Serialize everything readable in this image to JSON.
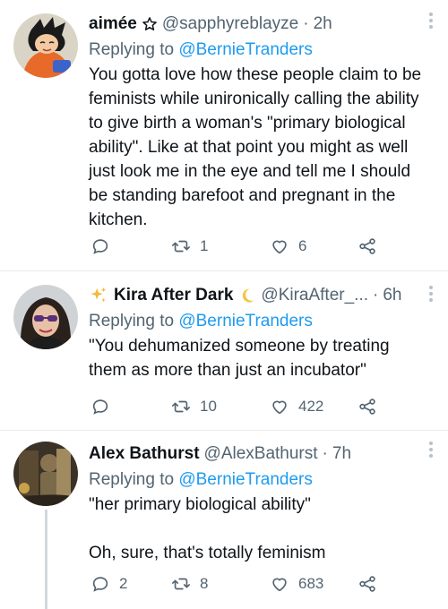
{
  "tweets": [
    {
      "name": "aimée",
      "handle": "@sapphyreblayze",
      "time": "2h",
      "replying_prefix": "Replying to ",
      "replying_to": "@BernieTranders",
      "text": "You gotta love how these people claim to be feminists while unironically calling the ability to give birth a woman's \"primary biological ability\". Like at that point you might as well just look me in the eye and tell me I should be standing barefoot and pregnant in the kitchen.",
      "reply_count": "",
      "retweet_count": "1",
      "like_count": "6",
      "name_icon": "star-outline-icon"
    },
    {
      "name": "Kira After Dark",
      "handle": "@KiraAfter_...",
      "time": "6h",
      "replying_prefix": "Replying to ",
      "replying_to": "@BernieTranders",
      "text": "\"You dehumanized someone by treating them as more than just an incubator\"",
      "reply_count": "",
      "retweet_count": "10",
      "like_count": "422",
      "name_icon_left": "sparkles-icon",
      "name_icon_right": "crescent-moon-icon"
    },
    {
      "name": "Alex Bathurst",
      "handle": "@AlexBathurst",
      "time": "7h",
      "replying_prefix": "Replying to ",
      "replying_to": "@BernieTranders",
      "text": "\"her primary biological ability\"\n\nOh, sure, that's totally feminism",
      "reply_count": "2",
      "retweet_count": "8",
      "like_count": "683"
    }
  ],
  "separator": "·",
  "colors": {
    "text": "#0f1419",
    "secondary": "#536471",
    "link": "#1d9bf0",
    "divider": "#e6ecf0"
  }
}
